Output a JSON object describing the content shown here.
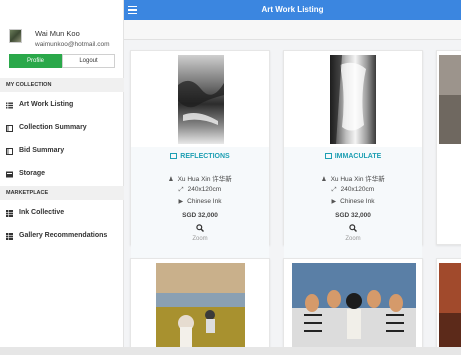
{
  "user": {
    "name": "Wai Mun Koo",
    "email": "waimunkoo@hotmail.com",
    "profile_label": "Profile",
    "logout_label": "Logout"
  },
  "sidebar": {
    "sections": [
      {
        "label": "MY COLLECTION",
        "items": [
          {
            "label": "Art Work Listing",
            "icon": "list-icon"
          },
          {
            "label": "Collection Summary",
            "icon": "book-icon"
          },
          {
            "label": "Bid Summary",
            "icon": "book-icon"
          },
          {
            "label": "Storage",
            "icon": "storage-icon"
          }
        ]
      },
      {
        "label": "MARKETPLACE",
        "items": [
          {
            "label": "Ink Collective",
            "icon": "grid-icon"
          },
          {
            "label": "Gallery Recommendations",
            "icon": "grid-icon"
          }
        ]
      }
    ]
  },
  "header": {
    "title": "Art Work Listing"
  },
  "cards": [
    {
      "title": "REFLECTIONS",
      "artist": "Xu Hua Xin 许华新",
      "size": "240x120cm",
      "medium": "Chinese Ink",
      "price": "SGD 32,000",
      "zoom_label": "Zoom"
    },
    {
      "title": "IMMACULATE",
      "artist": "Xu Hua Xin 许华新",
      "size": "240x120cm",
      "medium": "Chinese Ink",
      "price": "SGD 32,000",
      "zoom_label": "Zoom"
    }
  ],
  "colors": {
    "accent": "#3b86e0",
    "profile_button": "#2aa84a",
    "card_title": "#1e9fb3"
  }
}
